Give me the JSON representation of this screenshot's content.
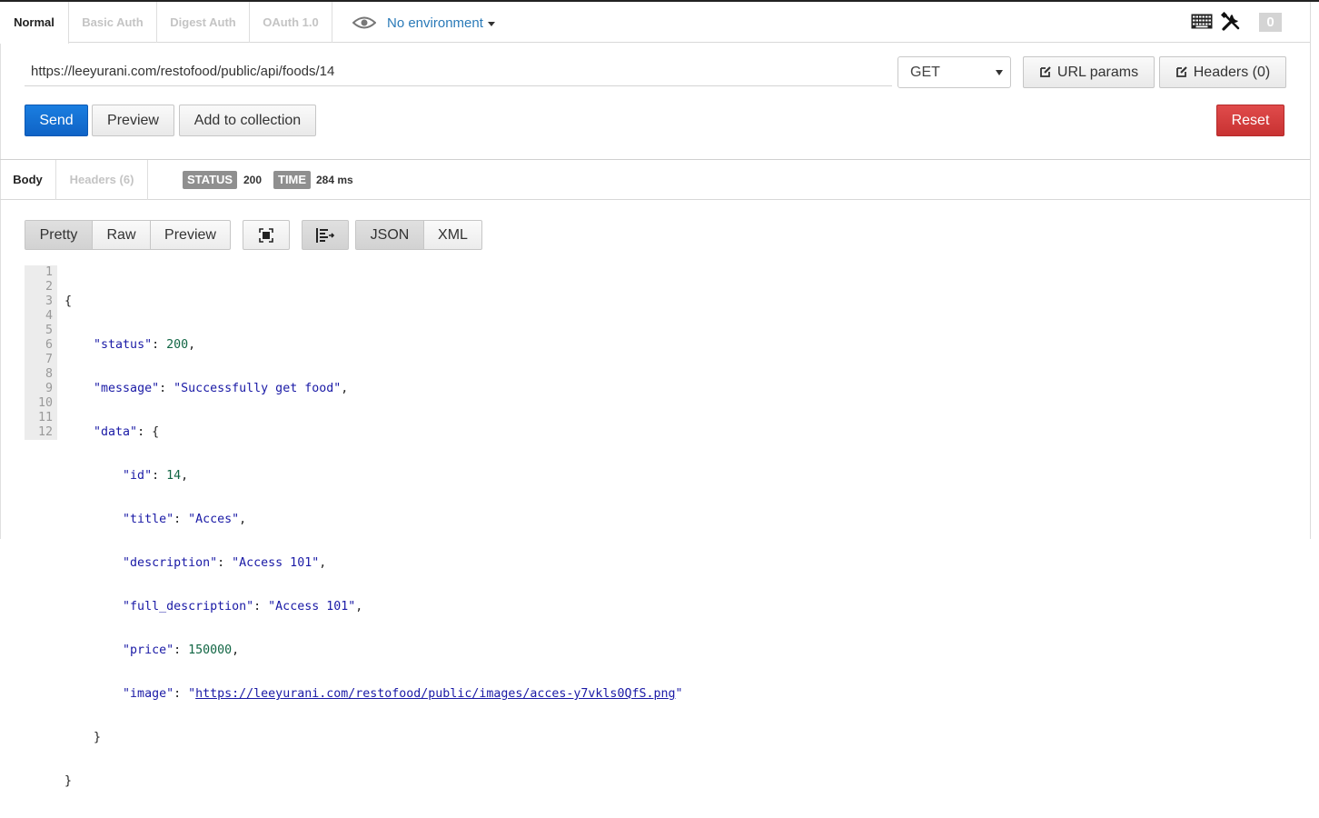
{
  "auth_tabs": [
    "Normal",
    "Basic Auth",
    "Digest Auth",
    "OAuth 1.0"
  ],
  "environment": {
    "label": "No environment",
    "icon": "eye-icon"
  },
  "header_right": {
    "keyboard_icon": "keyboard-icon",
    "tools_icon": "wrench-screwdriver-icon",
    "count": "0"
  },
  "request": {
    "url": "https://leeyurani.com/restofood/public/api/foods/14",
    "method": "GET",
    "url_params_label": "URL params",
    "headers_label": "Headers (0)"
  },
  "actions": {
    "send": "Send",
    "preview": "Preview",
    "add_to_collection": "Add to collection",
    "reset": "Reset"
  },
  "response": {
    "tabs": {
      "body": "Body",
      "headers": "Headers (6)"
    },
    "status_label": "STATUS",
    "status_value": "200",
    "time_label": "TIME",
    "time_value": "284 ms"
  },
  "view": {
    "modes": [
      "Pretty",
      "Raw",
      "Preview"
    ],
    "active_mode": "Pretty",
    "formats": [
      "JSON",
      "XML"
    ],
    "active_format": "JSON",
    "icons": [
      "fullscreen-icon",
      "wrap-lines-icon"
    ]
  },
  "code": {
    "line_numbers": [
      "1",
      "2",
      "3",
      "4",
      "5",
      "6",
      "7",
      "8",
      "9",
      "10",
      "11",
      "12"
    ],
    "l1": "{",
    "l2_key": "\"status\"",
    "l2_val": "200",
    "l3_key": "\"message\"",
    "l3_val": "\"Successfully get food\"",
    "l4_key": "\"data\"",
    "l5_key": "\"id\"",
    "l5_val": "14",
    "l6_key": "\"title\"",
    "l6_val": "\"Acces\"",
    "l7_key": "\"description\"",
    "l7_val": "\"Access 101\"",
    "l8_key": "\"full_description\"",
    "l8_val": "\"Access 101\"",
    "l9_key": "\"price\"",
    "l9_val": "150000",
    "l10_key": "\"image\"",
    "l10_link": "https://leeyurani.com/restofood/public/images/acces-y7vkls0QfS.png",
    "l11": "}",
    "l12": "}"
  }
}
